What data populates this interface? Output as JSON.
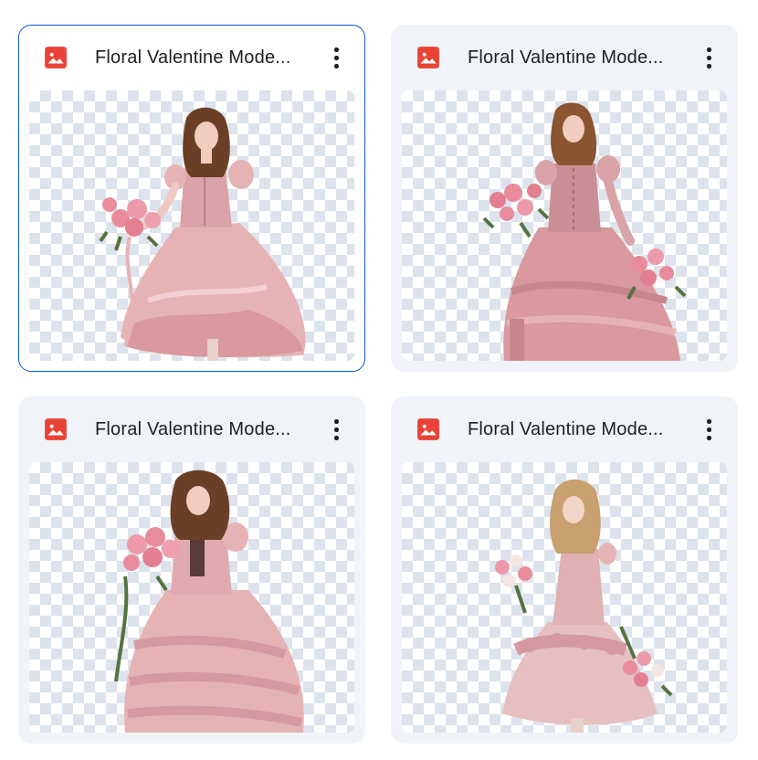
{
  "files": [
    {
      "title": "Floral Valentine Mode...",
      "icon": "image-file-icon",
      "selected": true
    },
    {
      "title": "Floral Valentine Mode...",
      "icon": "image-file-icon",
      "selected": false
    },
    {
      "title": "Floral Valentine Mode...",
      "icon": "image-file-icon",
      "selected": false
    },
    {
      "title": "Floral Valentine Mode...",
      "icon": "image-file-icon",
      "selected": false
    }
  ],
  "more_actions_icon": "more-vert-icon",
  "colors": {
    "icon_red": "#ea4335",
    "selection_border": "#0b57d0",
    "card_bg": "#f0f4f9",
    "dress_pink": "#e6b3b5",
    "rose_pink": "#e88c9c",
    "leaf_green": "#55733f",
    "hair_brown": "#6b3f26"
  }
}
